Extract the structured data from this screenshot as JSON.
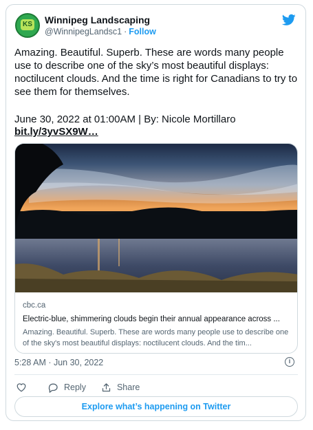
{
  "author": {
    "name": "Winnipeg Landscaping",
    "handle": "@WinnipegLandsc1",
    "separator": "·",
    "follow_label": "Follow",
    "avatar_text": "KS"
  },
  "tweet": {
    "text": "Amazing. Beautiful. Superb. These are words many people use to describe one of the sky’s most beautiful displays: noctilucent clouds. And the time is right for Canadians to try to see them for themselves.",
    "meta": "June 30, 2022 at 01:00AM | By: Nicole Mortillaro",
    "link": "bit.ly/3yvSX9W…"
  },
  "link_card": {
    "domain": "cbc.ca",
    "title": "Electric-blue, shimmering clouds begin their annual appearance across ...",
    "description": "Amazing. Beautiful. Superb. These are words many people use to describe one of the sky's most beautiful displays: noctilucent clouds. And the tim..."
  },
  "timestamp": "5:28 AM · Jun 30, 2022",
  "actions": {
    "reply": "Reply",
    "share": "Share"
  },
  "explore_label": "Explore what’s happening on Twitter",
  "icons": [
    "twitter-bird-icon",
    "info-icon",
    "heart-icon",
    "reply-icon",
    "share-icon"
  ],
  "colors": {
    "accent": "#1d9bf0",
    "muted": "#536471",
    "border": "#cfd9de"
  }
}
